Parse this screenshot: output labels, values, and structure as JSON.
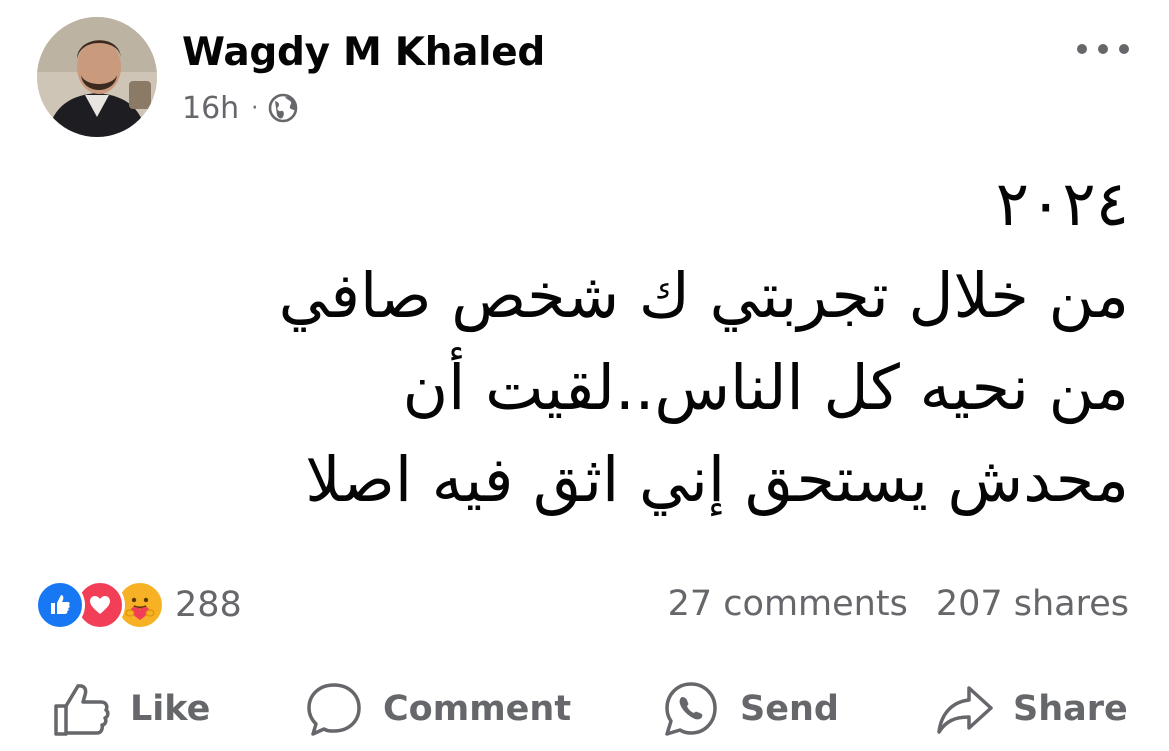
{
  "post": {
    "author_name": "Wagdy M Khaled",
    "timestamp": "16h",
    "separator": "·",
    "audience_icon": "globe-icon",
    "menu_icon": "more-options-icon",
    "text_lines": [
      "٢٠٢٤",
      "من خلال تجربتي ك شخص صافي",
      "من نحيه كل الناس..لقيت أن",
      "محدش يستحق إني اثق فيه اصلا"
    ]
  },
  "reactions": {
    "icons": [
      "like-reaction-icon",
      "love-reaction-icon",
      "care-reaction-icon"
    ],
    "count": "288"
  },
  "stats": {
    "comments": "27 comments",
    "shares": "207 shares"
  },
  "actions": {
    "like_label": "Like",
    "comment_label": "Comment",
    "send_label": "Send",
    "share_label": "Share"
  },
  "colors": {
    "like_blue": "#1877f2",
    "love_red": "#f33e58",
    "care_yellow": "#f7b125",
    "secondary_text": "#65676b",
    "primary_text": "#050505"
  }
}
